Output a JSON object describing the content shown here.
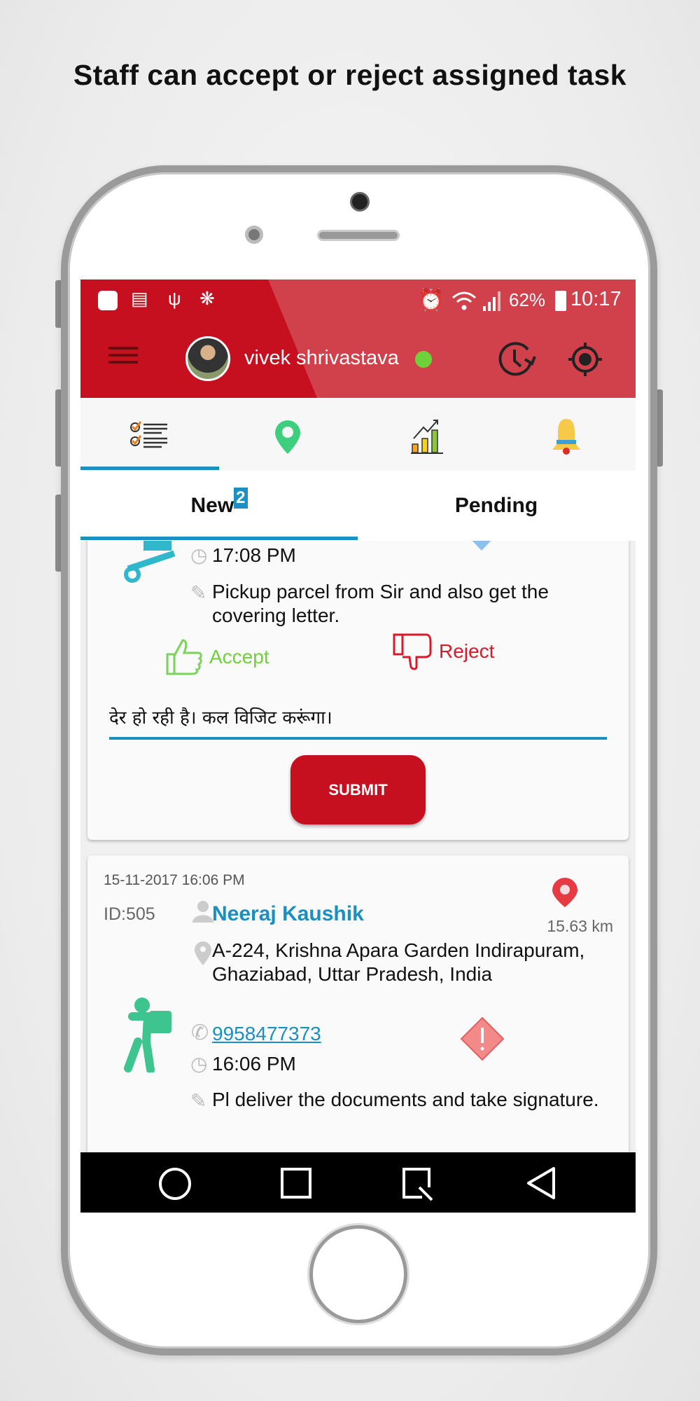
{
  "caption": "Staff can accept or reject assigned task",
  "status_bar": {
    "battery": "62%",
    "time": "10:17"
  },
  "header": {
    "user_name": "vivek shrivastava",
    "online_color": "#6fd13a",
    "brand_color": "#c60f1f"
  },
  "icon_tabs": [
    {
      "icon": "task-list-icon"
    },
    {
      "icon": "map-pin-icon"
    },
    {
      "icon": "growth-chart-icon"
    },
    {
      "icon": "bell-icon"
    }
  ],
  "sub_tabs": {
    "new_label": "New",
    "new_count": "2",
    "pending_label": "Pending"
  },
  "card1": {
    "time": "17:08 PM",
    "note": "Pickup parcel from Sir and also get the covering letter.",
    "accept_label": "Accept",
    "reject_label": "Reject",
    "remark_value": "देर हो रही है। कल विजिट करूंगा।",
    "submit_label": "SUBMIT"
  },
  "card2": {
    "datetime": "15-11-2017 16:06 PM",
    "id": "ID:505",
    "name": "Neeraj Kaushik",
    "distance": "15.63 km",
    "address": "A-224, Krishna Apara Garden Indirapuram, Ghaziabad, Uttar Pradesh, India",
    "phone": "9958477373",
    "time": "16:06 PM",
    "note": "Pl deliver the documents and take signature."
  }
}
